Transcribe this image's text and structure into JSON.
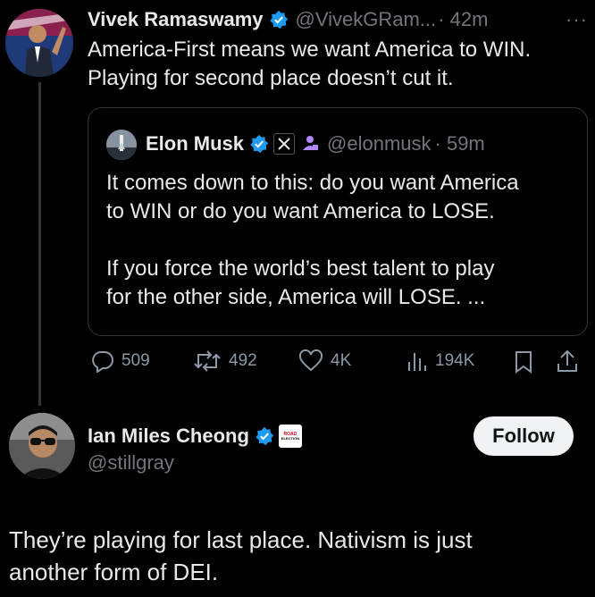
{
  "tweet": {
    "author_name": "Vivek Ramaswamy",
    "handle": "@VivekGRam...",
    "time": "· 42m",
    "more": "···",
    "text_line1": "America-First means we want America to WIN.",
    "text_line2": "Playing for second place doesn’t cut it.",
    "quote": {
      "author_name": "Elon Musk",
      "handle": "@elonmusk",
      "time": "· 59m",
      "para1_line1": "It comes down to this: do you want America",
      "para1_line2": "to WIN or do you want America to LOSE.",
      "para2_line1": "If you force the world’s best talent to play",
      "para2_line2": "for the other side, America will LOSE. ..."
    },
    "actions": {
      "replies": "509",
      "reposts": "492",
      "likes": "4K",
      "views": "194K"
    }
  },
  "reply": {
    "author_name": "Ian Miles Cheong",
    "handle": "@stillgray",
    "follow_label": "Follow",
    "badge_text_top": "ROAD",
    "badge_text_bottom": "ELECTION",
    "text_line1": "They’re playing for last place. Nativism is just",
    "text_line2": "another form of DEI."
  },
  "colors": {
    "verified": "#1d9bf0",
    "affiliate": "#b388ff"
  }
}
